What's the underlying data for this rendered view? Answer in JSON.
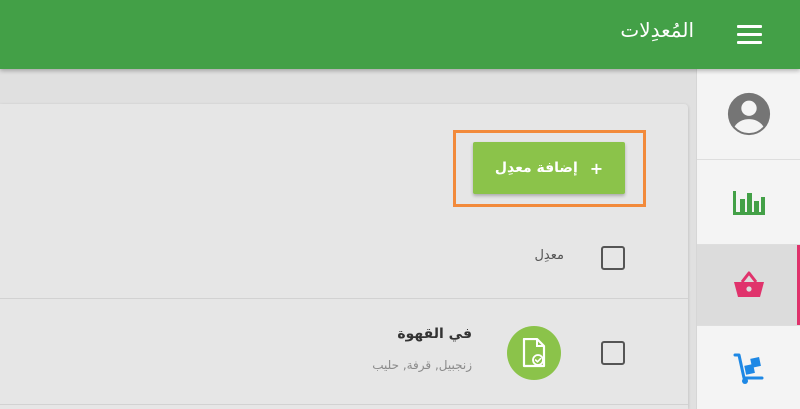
{
  "header": {
    "title": "المُعدِلات",
    "menu_icon": "hamburger-menu-icon"
  },
  "sidebar": {
    "items": [
      {
        "icon": "account-circle-icon",
        "color": "#757575"
      },
      {
        "icon": "bar-chart-icon",
        "color": "#43a047"
      },
      {
        "icon": "basket-icon",
        "color": "#e0336c",
        "active": true
      },
      {
        "icon": "hand-truck-icon",
        "color": "#1e88e5"
      }
    ]
  },
  "main": {
    "add_button_label": "إضافة معدِل",
    "add_button_icon": "+",
    "table_header_label": "معدِل",
    "rows": [
      {
        "title": "في القهوة",
        "subtitle": "زنجبيل, قرفة, حليب",
        "icon": "document-check-icon"
      }
    ]
  },
  "colors": {
    "primary": "#43a047",
    "accent": "#8bc34a",
    "active_indicator": "#e0336c",
    "highlight": "#f28a3b"
  }
}
